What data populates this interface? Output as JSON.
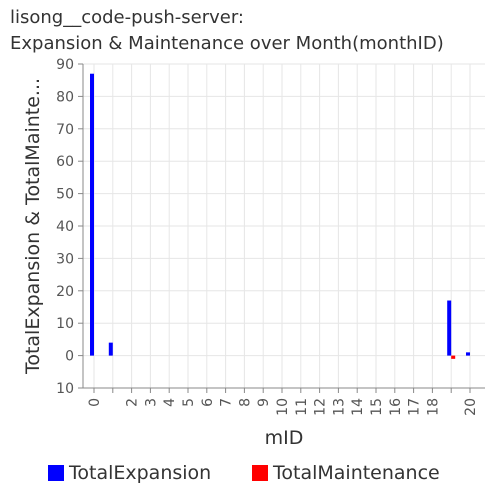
{
  "chart_data": {
    "type": "bar",
    "title_lines": [
      "lisong__code-push-server:",
      "Expansion & Maintenance over Month(monthID)"
    ],
    "xlabel": "mID",
    "ylabel": "TotalExpansion & TotalMainte...",
    "categories": [
      "0",
      "1",
      "2",
      "3",
      "4",
      "5",
      "6",
      "7",
      "8",
      "9",
      "10",
      "11",
      "12",
      "13",
      "14",
      "15",
      "16",
      "17",
      "18",
      "19",
      "20"
    ],
    "tick_labels": [
      "0",
      "2",
      "3",
      "4",
      "5",
      "6",
      "7",
      "8",
      "9",
      "10",
      "11",
      "12",
      "13",
      "14",
      "15",
      "16",
      "17",
      "18",
      "20"
    ],
    "ylim": [
      -10,
      90
    ],
    "yticks": [
      90,
      80,
      70,
      60,
      50,
      40,
      30,
      20,
      10,
      0,
      10
    ],
    "grid": true,
    "legend_position": "bottom",
    "series": [
      {
        "name": "TotalExpansion",
        "color": "#0000ff",
        "values": [
          87,
          4,
          0,
          0,
          0,
          0,
          0,
          0,
          0,
          0,
          0,
          0,
          0,
          0,
          0,
          0,
          0,
          0,
          0,
          17,
          1
        ]
      },
      {
        "name": "TotalMaintenance",
        "color": "#ff0000",
        "values": [
          0,
          0,
          0,
          0,
          0,
          0,
          0,
          0,
          0,
          0,
          0,
          0,
          0,
          0,
          0,
          0,
          0,
          0,
          0,
          -1,
          0
        ]
      }
    ]
  }
}
